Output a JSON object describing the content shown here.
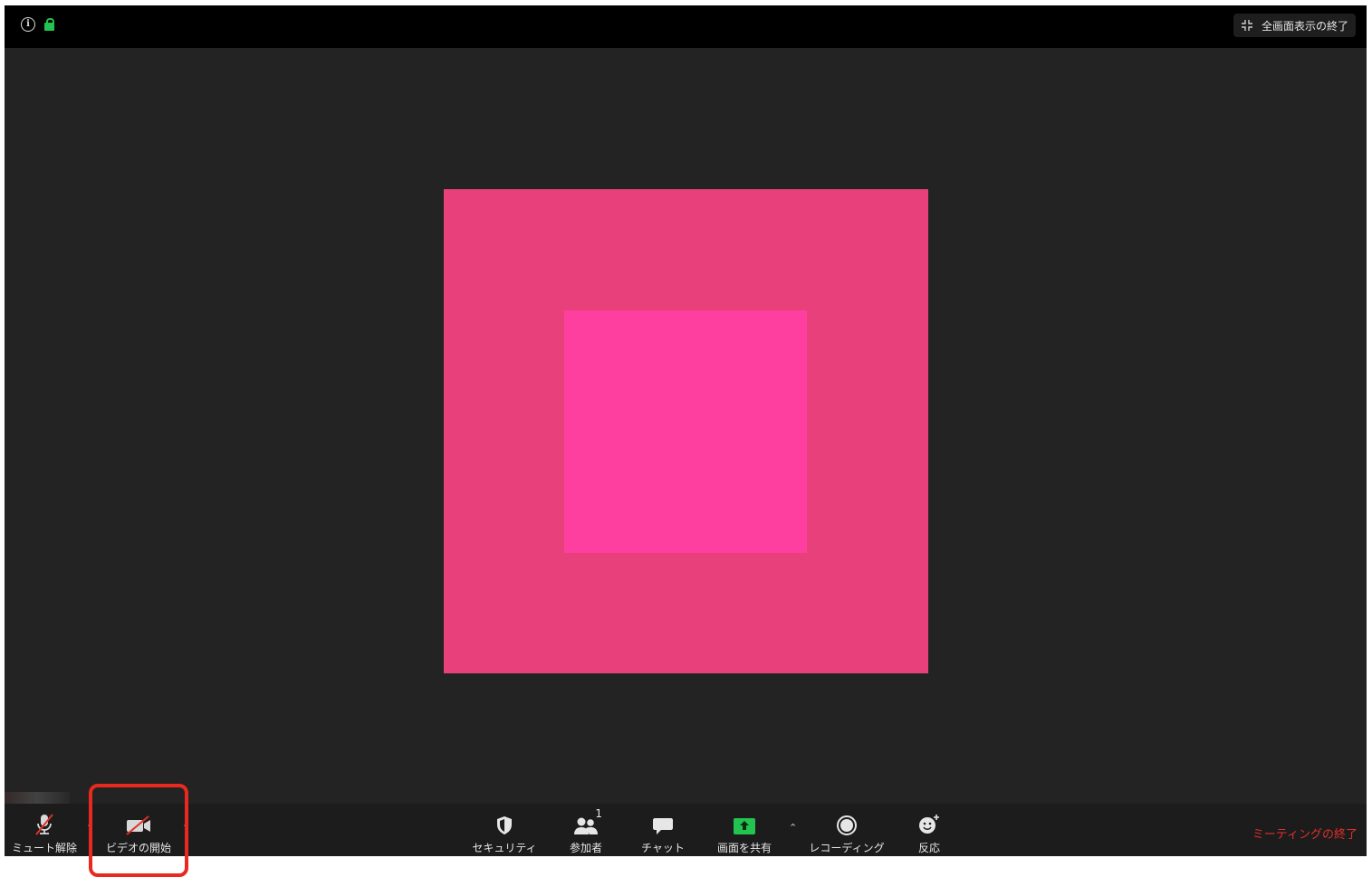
{
  "top_bar": {
    "info_icon": "info-icon",
    "lock_icon": "lock-icon",
    "lock_color": "#23c34f",
    "exit_fullscreen_label": "全画面表示の終了"
  },
  "video": {
    "outer_color": "#e8407a",
    "inner_color": "#ff3fa0"
  },
  "toolbar": {
    "mute_label": "ミュート解除",
    "video_label": "ビデオの開始",
    "security_label": "セキュリティ",
    "participants_label": "参加者",
    "participants_count": "1",
    "chat_label": "チャット",
    "share_label": "画面を共有",
    "recording_label": "レコーディング",
    "reactions_label": "反応",
    "end_label": "ミーティングの終了",
    "share_color": "#23c34f",
    "end_color": "#e0302b"
  },
  "annotation": {
    "highlight_color": "#e8291f"
  }
}
